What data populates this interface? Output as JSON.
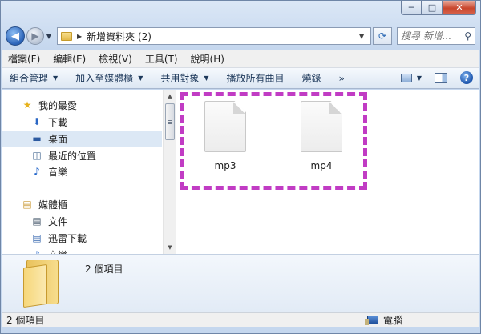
{
  "window": {
    "minimize": "─",
    "maximize": "□",
    "close": "✕"
  },
  "address": {
    "path": "新增資料夾 (2)",
    "search_placeholder": "搜尋 新增...",
    "back_glyph": "◀",
    "forward_glyph": "▶"
  },
  "menu": [
    "檔案(F)",
    "編輯(E)",
    "檢視(V)",
    "工具(T)",
    "說明(H)"
  ],
  "commands": [
    {
      "label": "組合管理",
      "dropdown": true
    },
    {
      "label": "加入至媒體櫃",
      "dropdown": true
    },
    {
      "label": "共用對象",
      "dropdown": true
    },
    {
      "label": "播放所有曲目",
      "dropdown": false
    },
    {
      "label": "燒錄",
      "dropdown": false
    }
  ],
  "more_glyph": "»",
  "help_glyph": "?",
  "nav": {
    "items": [
      {
        "label": "我的最愛",
        "icon": "star-icon",
        "glyph": "★",
        "color": "#e7b21c"
      },
      {
        "label": "下載",
        "icon": "download-icon",
        "glyph": "⬇",
        "color": "#2a66c4"
      },
      {
        "label": "桌面",
        "icon": "desktop-icon",
        "glyph": "▬",
        "color": "#2c5aa0"
      },
      {
        "label": "最近的位置",
        "icon": "recent-places-icon",
        "glyph": "◫",
        "color": "#4a6c94"
      },
      {
        "label": "音樂",
        "icon": "music-icon",
        "glyph": "♪",
        "color": "#1f63c9"
      },
      {
        "label": "媒體櫃",
        "icon": "libraries-icon",
        "glyph": "▤",
        "color": "#c8962e"
      },
      {
        "label": "文件",
        "icon": "documents-icon",
        "glyph": "▤",
        "color": "#567"
      },
      {
        "label": "迅雷下載",
        "icon": "thunder-download-icon",
        "glyph": "▤",
        "color": "#3a6ab0"
      },
      {
        "label": "音樂",
        "icon": "music-library-icon",
        "glyph": "♪",
        "color": "#1f63c9"
      }
    ]
  },
  "files": [
    {
      "name": "mp3"
    },
    {
      "name": "mp4"
    }
  ],
  "details": {
    "count": "2 個項目"
  },
  "status": {
    "left": "2 個項目",
    "right": "電腦"
  }
}
